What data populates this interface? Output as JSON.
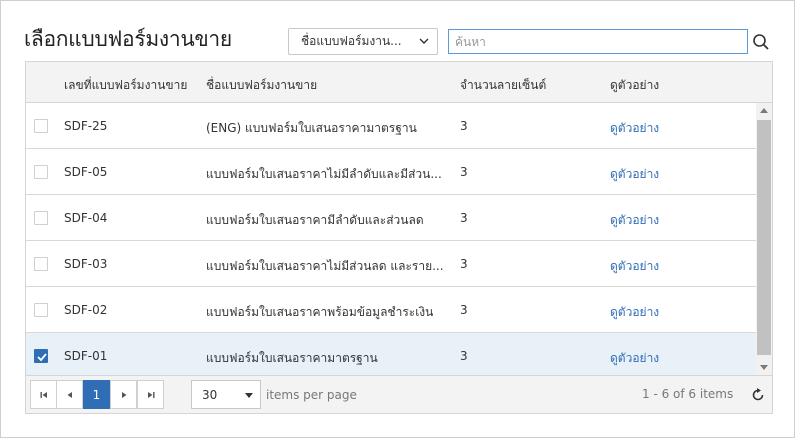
{
  "title": "เลือกแบบฟอร์มงานขาย",
  "filter_dropdown": {
    "selected": "ชื่อแบบฟอร์มงาน..."
  },
  "search": {
    "placeholder": "ค้นหา",
    "value": ""
  },
  "columns": {
    "code": "เลขที่แบบฟอร์มงานขาย",
    "name": "ชื่อแบบฟอร์มงานขาย",
    "signatures": "จำนวนลายเซ็นต์",
    "preview": "ดูตัวอย่าง"
  },
  "rows": [
    {
      "code": "SDF-25",
      "name": "(ENG) แบบฟอร์มใบเสนอราคามาตรฐาน",
      "signatures": "3",
      "preview": "ดูตัวอย่าง",
      "checked": false
    },
    {
      "code": "SDF-05",
      "name": "แบบฟอร์มใบเสนอราคาไม่มีลำดับและมีส่วน...",
      "signatures": "3",
      "preview": "ดูตัวอย่าง",
      "checked": false
    },
    {
      "code": "SDF-04",
      "name": "แบบฟอร์มใบเสนอราคามีลำดับและส่วนลด",
      "signatures": "3",
      "preview": "ดูตัวอย่าง",
      "checked": false
    },
    {
      "code": "SDF-03",
      "name": "แบบฟอร์มใบเสนอราคาไม่มีส่วนลด และราย...",
      "signatures": "3",
      "preview": "ดูตัวอย่าง",
      "checked": false
    },
    {
      "code": "SDF-02",
      "name": "แบบฟอร์มใบเสนอราคาพร้อมข้อมูลชำระเงิน",
      "signatures": "3",
      "preview": "ดูตัวอย่าง",
      "checked": false
    },
    {
      "code": "SDF-01",
      "name": "แบบฟอร์มใบเสนอราคามาตรฐาน",
      "signatures": "3",
      "preview": "ดูตัวอย่าง",
      "checked": true
    }
  ],
  "pager": {
    "current_page": "1",
    "page_size": "30",
    "items_per_page_label": "items per page",
    "range_text": "1 - 6 of 6 items"
  },
  "colors": {
    "accent": "#2f6db5",
    "selected_row": "#e8f0f8",
    "header_bg": "#f3f3f3"
  }
}
